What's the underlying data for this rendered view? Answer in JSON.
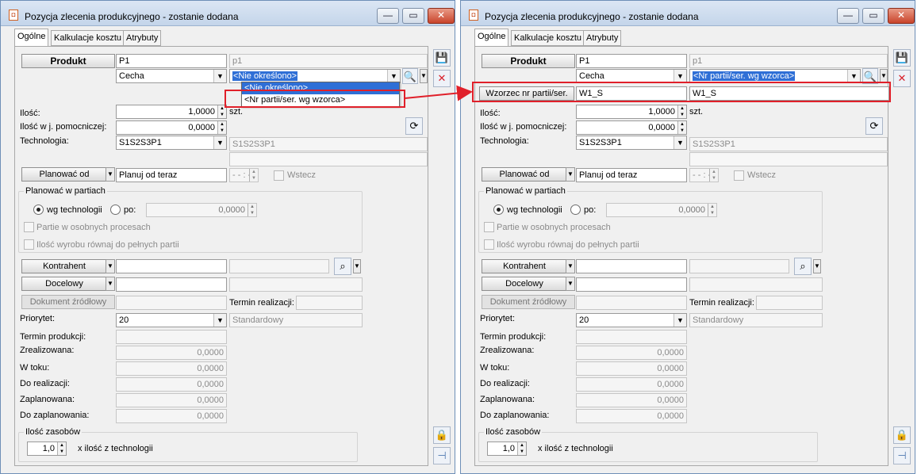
{
  "window_title": "Pozycja zlecenia produkcyjnego - zostanie dodana",
  "title_buttons": {
    "minimize": "—",
    "maximize": "▭",
    "close": "✕"
  },
  "tabs": [
    "Ogólne",
    "Kalkulacje kosztu",
    "Atrybuty"
  ],
  "product": {
    "button_label": "Produkt",
    "code": "P1",
    "name": "p1",
    "feature_label": "Cecha",
    "feature_left": "<Nie określono>",
    "feature_right": "<Nr partii/ser. wg wzorca>"
  },
  "dropdown_options": [
    "<Nie określono>",
    "<Nr partii/ser. wg wzorca>"
  ],
  "batch_pattern": {
    "button_label": "Wzorzec nr partii/ser.",
    "value": "W1_S",
    "value2": "W1_S"
  },
  "quantity": {
    "label": "Ilość:",
    "value": "1,0000",
    "unit": "szt."
  },
  "quantity_aux": {
    "label": "Ilość w j. pomocniczej:",
    "value": "0,0000"
  },
  "technology": {
    "label": "Technologia:",
    "value": "S1S2S3P1",
    "name": "S1S2S3P1"
  },
  "plan": {
    "button_label": "Planować od",
    "value": "Planuj od teraz",
    "time": "- - : -",
    "backward_label": "Wstecz"
  },
  "batches": {
    "title": "Planować w partiach",
    "by_tech_label": "wg technologii",
    "by_label": "po:",
    "by_value": "0,0000",
    "separate_label": "Partie w osobnych procesach",
    "full_label": "Ilość wyrobu równaj do pełnych partii"
  },
  "contractor": {
    "button_label": "Kontrahent"
  },
  "target": {
    "button_label": "Docelowy"
  },
  "source_doc": {
    "button_label": "Dokument źródłowy",
    "deadline_label": "Termin realizacji:"
  },
  "priority": {
    "label": "Priorytet:",
    "value": "20",
    "name": "Standardowy"
  },
  "production_date_label": "Termin produkcji:",
  "status_rows": [
    {
      "label": "Zrealizowana:",
      "value": "0,0000"
    },
    {
      "label": "W toku:",
      "value": "0,0000"
    },
    {
      "label": "Do realizacji:",
      "value": "0,0000"
    },
    {
      "label": "Zaplanowana:",
      "value": "0,0000"
    },
    {
      "label": "Do zaplanowania:",
      "value": "0,0000"
    }
  ],
  "resources": {
    "title": "Ilość zasobów",
    "value": "1,0",
    "suffix": "x ilość z technologii"
  },
  "accent_colors": {
    "highlight": "#2f6fd6",
    "annotation": "#e0202a"
  }
}
